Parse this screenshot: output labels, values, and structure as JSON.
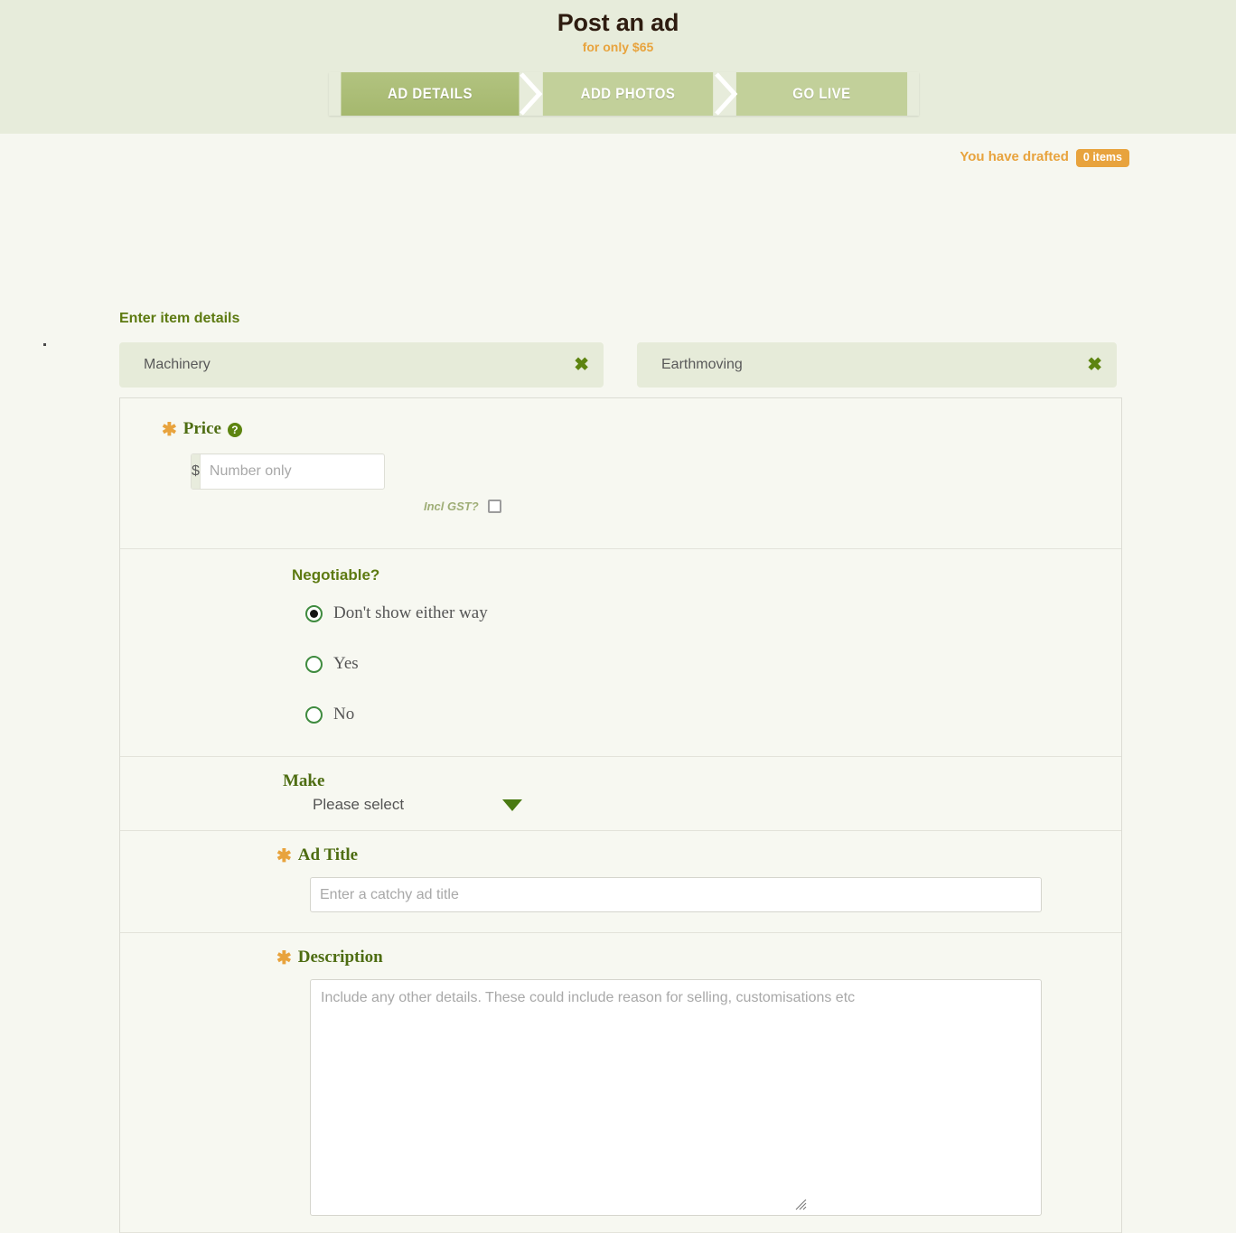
{
  "header": {
    "title": "Post an ad",
    "subtitle": "for only $65",
    "steps": [
      {
        "label": "AD DETAILS",
        "state": "active"
      },
      {
        "label": "ADD PHOTOS",
        "state": "inactive"
      },
      {
        "label": "GO LIVE",
        "state": "inactive"
      }
    ]
  },
  "drafted": {
    "text": "You have drafted",
    "badge": "0 items"
  },
  "main": {
    "section_heading": "Enter item details",
    "categories": [
      {
        "label": "Machinery",
        "remove_icon": "✖"
      },
      {
        "label": "Earthmoving",
        "remove_icon": "✖"
      }
    ]
  },
  "form": {
    "price": {
      "label": "Price",
      "required_marker": "✱",
      "help_icon": "?",
      "currency_prefix": "$",
      "placeholder": "Number only",
      "value": "",
      "gst_label": "Incl GST?",
      "gst_checked": false
    },
    "negotiable": {
      "label": "Negotiable?",
      "options": [
        {
          "label": "Don't show either way",
          "selected": true
        },
        {
          "label": "Yes",
          "selected": false
        },
        {
          "label": "No",
          "selected": false
        }
      ]
    },
    "make": {
      "label": "Make",
      "selected": "Please select"
    },
    "ad_title": {
      "label": "Ad Title",
      "required_marker": "✱",
      "placeholder": "Enter a catchy ad title",
      "value": ""
    },
    "description": {
      "label": "Description",
      "required_marker": "✱",
      "placeholder": "Include any other details. These could include reason for selling, customisations etc",
      "value": ""
    }
  },
  "colors": {
    "header_bg": "#e7ecdb",
    "page_bg": "#f6f7f0",
    "accent_orange": "#e8a33d",
    "accent_green": "#5d7a11",
    "step_active": "#a9bd75",
    "step_inactive": "#c2d09a"
  }
}
